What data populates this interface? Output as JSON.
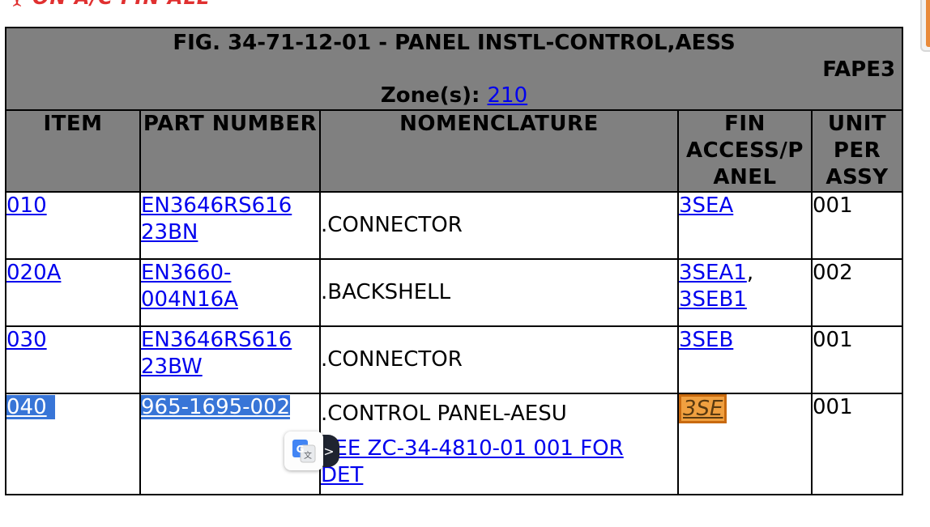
{
  "banner": {
    "text": "ON A/C FIN ALL",
    "icon": "airplane-icon",
    "color": "#e03030"
  },
  "figure": {
    "title": "FIG. 34-71-12-01 - PANEL INSTL-CONTROL,AESS",
    "code": "FAPE3",
    "zone_label": "Zone(s):",
    "zone_value": "210"
  },
  "columns": {
    "item": "ITEM",
    "part_number": "PART NUMBER",
    "nomenclature": "NOMENCLATURE",
    "fin_line1": "FIN",
    "fin_line2": "ACCESS/P",
    "fin_line3": "ANEL",
    "unit_line1": "UNIT",
    "unit_line2": "PER",
    "unit_line3": "ASSY"
  },
  "rows": [
    {
      "item": "010",
      "part_line1": "EN3646RS616",
      "part_line2": "23BN",
      "nomenclature": ".CONNECTOR",
      "fin": [
        "3SEA"
      ],
      "qty": "001"
    },
    {
      "item": "020A",
      "part_line1": "EN3660-",
      "part_line2": "004N16A",
      "nomenclature": ".BACKSHELL",
      "fin": [
        "3SEA1",
        "3SEB1"
      ],
      "fin_separator": ",",
      "qty": "002"
    },
    {
      "item": "030",
      "part_line1": "EN3646RS616",
      "part_line2": "23BW",
      "nomenclature": ".CONNECTOR",
      "fin": [
        "3SEB"
      ],
      "qty": "001"
    },
    {
      "item": "040",
      "part_line1": "965-1695-002",
      "nomenclature": ".CONTROL PANEL-AESU",
      "see_line1": "SEE ZC-34-4810-01 001 FOR",
      "see_line2": "DET",
      "fin": [
        "3SE"
      ],
      "qty": "001"
    }
  ],
  "colors": {
    "header_bg": "#808080",
    "link": "#0000ee",
    "selection": "#3875d7",
    "fin_highlight": "#f0a040"
  },
  "translate_widget": {
    "icon": "google-translate-icon",
    "arrow": ">"
  }
}
